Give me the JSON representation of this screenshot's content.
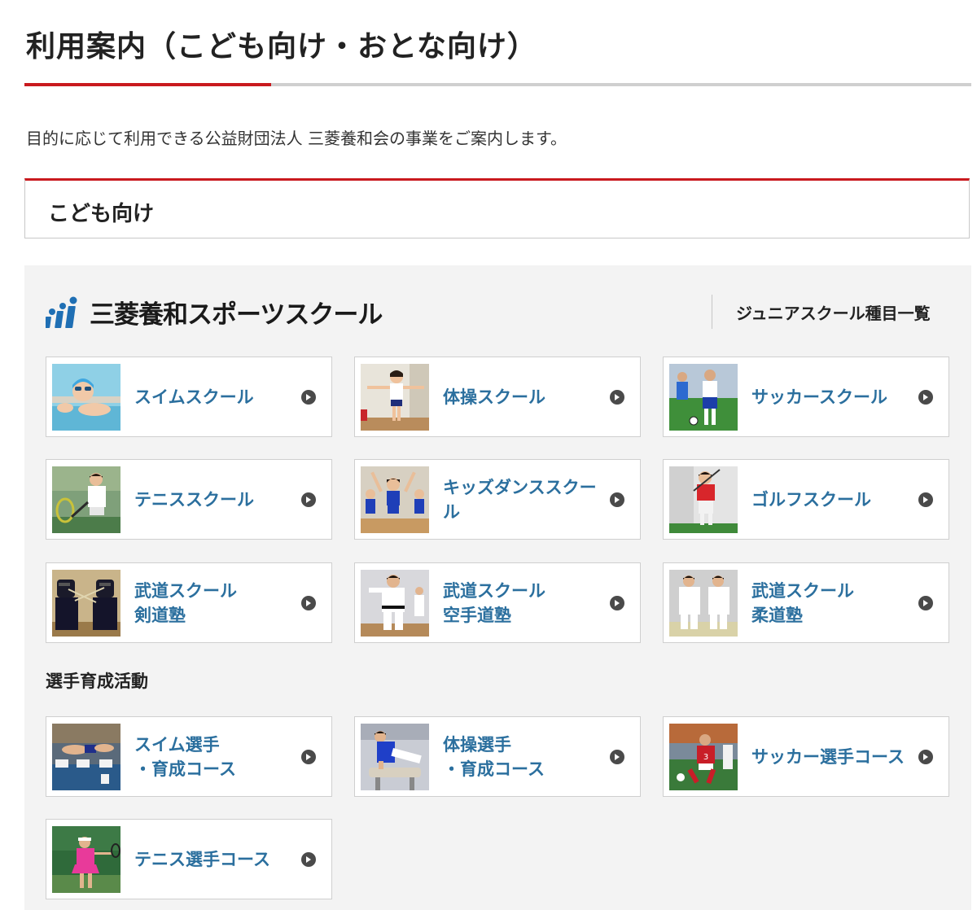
{
  "page": {
    "title": "利用案内（こども向け・おとな向け）",
    "intro": "目的に応じて利用できる公益財団法人 三菱養和会の事業をご案内します。"
  },
  "section": {
    "title": "こども向け"
  },
  "school": {
    "logo_text": "三菱養和スポーツスクール",
    "junior_list_link": "ジュニアスクール種目一覧",
    "brand_color": "#1f6fb4"
  },
  "junior_cards": [
    {
      "label": "スイムスクール",
      "photo": "swimming-child-photo"
    },
    {
      "label": "体操スクール",
      "photo": "gymnastics-child-photo"
    },
    {
      "label": "サッカースクール",
      "photo": "soccer-child-photo"
    },
    {
      "label": "テニススクール",
      "photo": "tennis-child-photo"
    },
    {
      "label": "キッズダンススクール",
      "photo": "dance-children-photo"
    },
    {
      "label": "ゴルフスクール",
      "photo": "golf-child-photo"
    },
    {
      "label": "武道スクール\n剣道塾",
      "photo": "kendo-photo"
    },
    {
      "label": "武道スクール\n空手道塾",
      "photo": "karate-photo"
    },
    {
      "label": "武道スクール\n柔道塾",
      "photo": "judo-photo"
    }
  ],
  "athlete_section": {
    "title": "選手育成活動"
  },
  "athlete_cards": [
    {
      "label": "スイム選手\n・育成コース",
      "photo": "swim-athlete-photo"
    },
    {
      "label": "体操選手\n・育成コース",
      "photo": "gymnast-athlete-photo"
    },
    {
      "label": "サッカー選手コース",
      "photo": "soccer-athlete-photo"
    },
    {
      "label": "テニス選手コース",
      "photo": "tennis-athlete-photo"
    }
  ],
  "colors": {
    "accent_red": "#c9191e",
    "link_blue": "#2b6f9e",
    "panel_bg": "#f3f3f3"
  }
}
